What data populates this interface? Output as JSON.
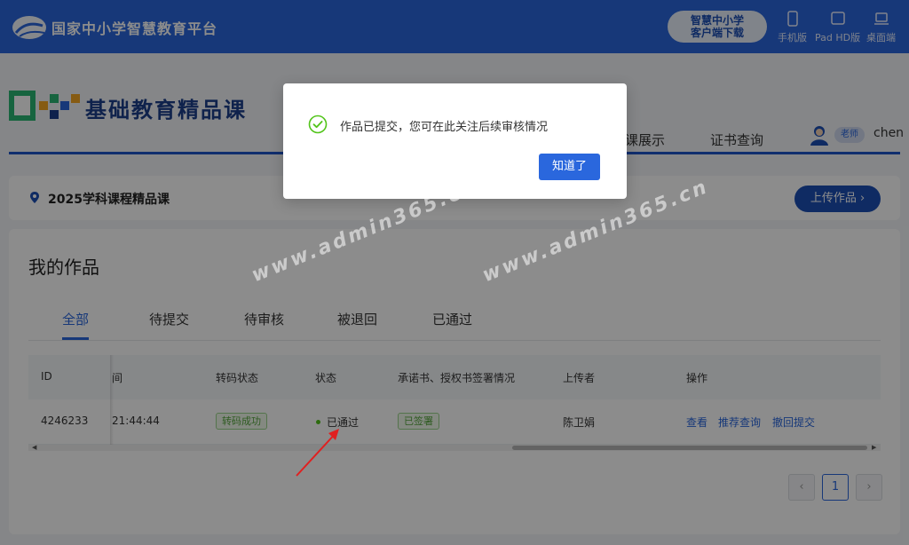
{
  "topbar": {
    "platform_name": "国家中小学智慧教育平台",
    "download_line1": "智慧中小学",
    "download_line2": "客户端下载",
    "devices": [
      "手机版",
      "Pad HD版",
      "桌面端"
    ]
  },
  "brand": {
    "title": "基础教育精品课",
    "nav": [
      "课展示",
      "证书查询"
    ],
    "user_role": "老师",
    "user_name": "chen"
  },
  "course": {
    "title": "2025学科课程精品课",
    "upload_label": "上传作品 ›"
  },
  "works": {
    "title": "我的作品",
    "tabs": [
      "全部",
      "待提交",
      "待审核",
      "被退回",
      "已通过"
    ],
    "active_tab": "全部",
    "table": {
      "headers": [
        "ID",
        "间",
        "转码状态",
        "状态",
        "承诺书、授权书签署情况",
        "上传者",
        "操作"
      ],
      "rows": [
        {
          "id": "4246233",
          "time": "21:44:44",
          "transcode": "转码成功",
          "status": "已通过",
          "signature": "已签署",
          "uploader": "陈卫娟",
          "actions": [
            "查看",
            "推荐查询",
            "撤回提交"
          ]
        }
      ]
    },
    "pagination": {
      "prev": "‹",
      "current": "1",
      "next": "›"
    }
  },
  "dialog": {
    "message": "作品已提交，您可在此关注后续审核情况",
    "confirm_label": "知道了"
  },
  "watermark": [
    "www.admin365.cn",
    "www.admin365.cn"
  ],
  "colors": {
    "primary": "#2a67dd",
    "brand_dark": "#1d4fb5",
    "success": "#52c41a"
  }
}
